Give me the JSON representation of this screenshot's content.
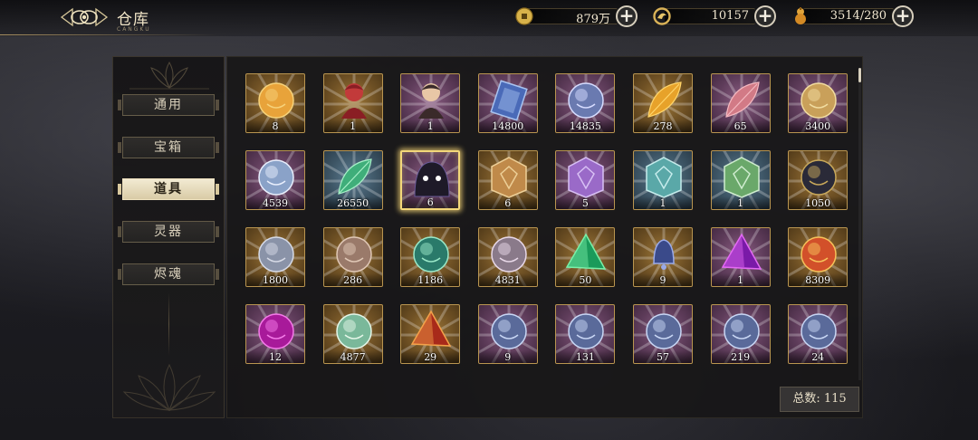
{
  "header": {
    "title": "仓库",
    "subtitle": "CANGKU"
  },
  "currencies": [
    {
      "name": "copper-coin",
      "icon": "coin-icon",
      "value": "879万"
    },
    {
      "name": "jade-token",
      "icon": "dragon-token-icon",
      "value": "10157"
    },
    {
      "name": "stamina",
      "icon": "gourd-icon",
      "value": "3514/280"
    }
  ],
  "tabs": [
    {
      "label": "通用",
      "active": false
    },
    {
      "label": "宝箱",
      "active": false
    },
    {
      "label": "道具",
      "active": true
    },
    {
      "label": "灵器",
      "active": false
    },
    {
      "label": "烬魂",
      "active": false
    }
  ],
  "items": [
    {
      "qty": "8",
      "frame": "gold",
      "icon": "golden-orb-pendant-icon"
    },
    {
      "qty": "1",
      "frame": "gold",
      "icon": "red-armor-figure-icon"
    },
    {
      "qty": "1",
      "frame": "purple",
      "icon": "chibi-character-icon"
    },
    {
      "qty": "14800",
      "frame": "purple",
      "icon": "blue-scroll-book-icon"
    },
    {
      "qty": "14835",
      "frame": "purple",
      "icon": "spirit-lantern-icon"
    },
    {
      "qty": "278",
      "frame": "gold",
      "icon": "golden-feather-icon"
    },
    {
      "qty": "65",
      "frame": "purple",
      "icon": "pink-petal-icon"
    },
    {
      "qty": "3400",
      "frame": "purple",
      "icon": "golden-triskelion-coin-icon"
    },
    {
      "qty": "4539",
      "frame": "purple",
      "icon": "silver-beast-medallion-icon"
    },
    {
      "qty": "26550",
      "frame": "blue",
      "icon": "jade-leaf-icon"
    },
    {
      "qty": "6",
      "frame": "purple",
      "icon": "dark-spirit-blob-icon",
      "selected": true
    },
    {
      "qty": "6",
      "frame": "gold",
      "icon": "bronze-talisman-icon"
    },
    {
      "qty": "5",
      "frame": "purple",
      "icon": "purple-talisman-icon"
    },
    {
      "qty": "1",
      "frame": "blue",
      "icon": "teal-talisman-icon"
    },
    {
      "qty": "1",
      "frame": "blue",
      "icon": "green-talisman-icon"
    },
    {
      "qty": "1050",
      "frame": "gold",
      "icon": "star-chart-fan-icon"
    },
    {
      "qty": "1800",
      "frame": "gold",
      "icon": "mushroom-relic-icon"
    },
    {
      "qty": "286",
      "frame": "gold",
      "icon": "pinecone-relic-icon"
    },
    {
      "qty": "1186",
      "frame": "gold",
      "icon": "jade-crystal-cluster-icon"
    },
    {
      "qty": "4831",
      "frame": "gold",
      "icon": "pearl-orb-relic-icon"
    },
    {
      "qty": "50",
      "frame": "gold",
      "icon": "green-crystal-shard-icon"
    },
    {
      "qty": "9",
      "frame": "gold",
      "icon": "blue-bell-icon"
    },
    {
      "qty": "1",
      "frame": "purple",
      "icon": "purple-crystal-prism-icon"
    },
    {
      "qty": "8309",
      "frame": "gold",
      "icon": "fire-spiral-shell-icon"
    },
    {
      "qty": "12",
      "frame": "purple",
      "icon": "magenta-orb-icon"
    },
    {
      "qty": "4877",
      "frame": "gold",
      "icon": "jade-lotus-icon"
    },
    {
      "qty": "29",
      "frame": "gold",
      "icon": "amber-pyramid-icon"
    },
    {
      "qty": "9",
      "frame": "purple",
      "icon": "crystal-sphere-icon"
    },
    {
      "qty": "131",
      "frame": "purple",
      "icon": "crystal-sphere-icon"
    },
    {
      "qty": "57",
      "frame": "purple",
      "icon": "crystal-sphere-icon"
    },
    {
      "qty": "219",
      "frame": "purple",
      "icon": "crystal-sphere-icon"
    },
    {
      "qty": "24",
      "frame": "purple",
      "icon": "crystal-sphere-icon"
    }
  ],
  "total": {
    "label": "总数: 115"
  },
  "colors": {
    "gold_frame": "#b99550",
    "selected_glow": "#f3d77a",
    "active_tab": "#f2ead2"
  }
}
